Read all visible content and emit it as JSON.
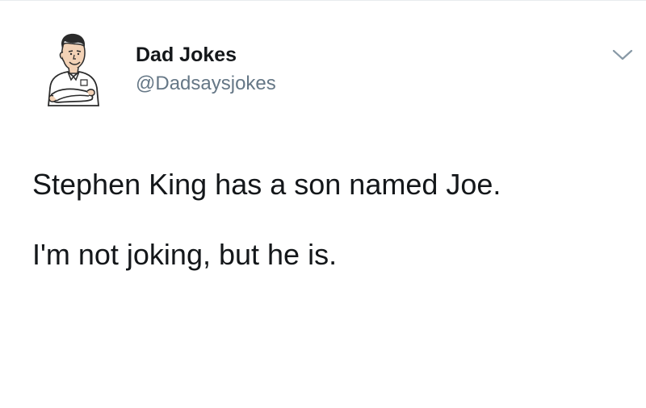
{
  "author": {
    "display_name": "Dad Jokes",
    "handle": "@Dadsaysjokes",
    "avatar_icon": "cartoon-man-arms-crossed-avatar"
  },
  "menu": {
    "icon": "chevron-down-icon"
  },
  "tweet": {
    "lines": [
      "Stephen King has a son named Joe.",
      "I'm not joking, but he is."
    ]
  },
  "colors": {
    "text": "#14171a",
    "secondary_text": "#657786",
    "background": "#ffffff"
  }
}
